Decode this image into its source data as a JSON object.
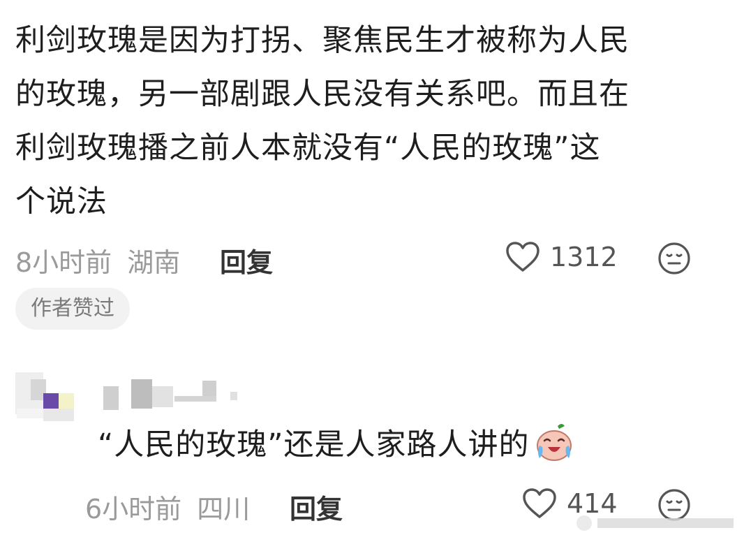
{
  "comment": {
    "lines": [
      "利剑玫瑰是因为打拐、聚焦民生才被称为人民",
      "的玫瑰，另一部剧跟人民没有关系吧。而且在",
      "利剑玫瑰播之前人本就没有“人民的玫瑰”这",
      "个说法"
    ],
    "time": "8小时前",
    "location": "湖南",
    "reply_label": "回复",
    "like_count": "1312",
    "badge": "作者赞过"
  },
  "sub_reply": {
    "text": "“人民的玫瑰”还是人家路人讲的",
    "emoji_icon": "crying-laughing-sticker-icon",
    "time": "6小时前",
    "location": "四川",
    "reply_label": "回复",
    "like_count": "414"
  },
  "colors": {
    "text": "#1e1e1e",
    "meta": "#9a9a9a",
    "badge_bg": "#f2f2f2"
  }
}
